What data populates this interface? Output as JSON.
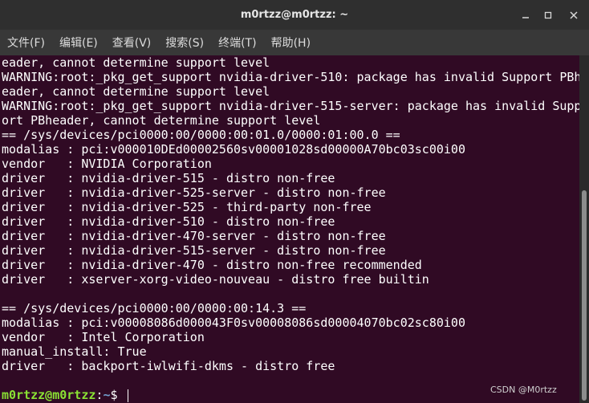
{
  "window": {
    "title": "m0rtzz@m0rtzz: ~"
  },
  "controls": {
    "minimize_icon": "minimize-icon",
    "maximize_icon": "maximize-icon",
    "close_icon": "close-icon"
  },
  "menubar": {
    "items": [
      {
        "label": "文件(F)"
      },
      {
        "label": "编辑(E)"
      },
      {
        "label": "查看(V)"
      },
      {
        "label": "搜索(S)"
      },
      {
        "label": "终端(T)"
      },
      {
        "label": "帮助(H)"
      }
    ]
  },
  "terminal": {
    "lines": [
      "eader, cannot determine support level",
      "WARNING:root:_pkg_get_support nvidia-driver-510: package has invalid Support PBh",
      "eader, cannot determine support level",
      "WARNING:root:_pkg_get_support nvidia-driver-515-server: package has invalid Supp",
      "ort PBheader, cannot determine support level",
      "== /sys/devices/pci0000:00/0000:00:01.0/0000:01:00.0 ==",
      "modalias : pci:v000010DEd00002560sv00001028sd00000A70bc03sc00i00",
      "vendor   : NVIDIA Corporation",
      "driver   : nvidia-driver-515 - distro non-free",
      "driver   : nvidia-driver-525-server - distro non-free",
      "driver   : nvidia-driver-525 - third-party non-free",
      "driver   : nvidia-driver-510 - distro non-free",
      "driver   : nvidia-driver-470-server - distro non-free",
      "driver   : nvidia-driver-515-server - distro non-free",
      "driver   : nvidia-driver-470 - distro non-free recommended",
      "driver   : xserver-xorg-video-nouveau - distro free builtin",
      "",
      "== /sys/devices/pci0000:00/0000:00:14.3 ==",
      "modalias : pci:v00008086d000043F0sv00008086sd00004070bc02sc80i00",
      "vendor   : Intel Corporation",
      "manual_install: True",
      "driver   : backport-iwlwifi-dkms - distro free",
      ""
    ],
    "prompt": {
      "user": "m0rtzz@m0rtzz",
      "separator": ":",
      "path": "~",
      "symbol": "$ "
    }
  },
  "colors": {
    "background": "#300a24",
    "prompt_user": "#8ae234",
    "prompt_path": "#729fcf"
  },
  "watermark": "CSDN @M0rtzz"
}
